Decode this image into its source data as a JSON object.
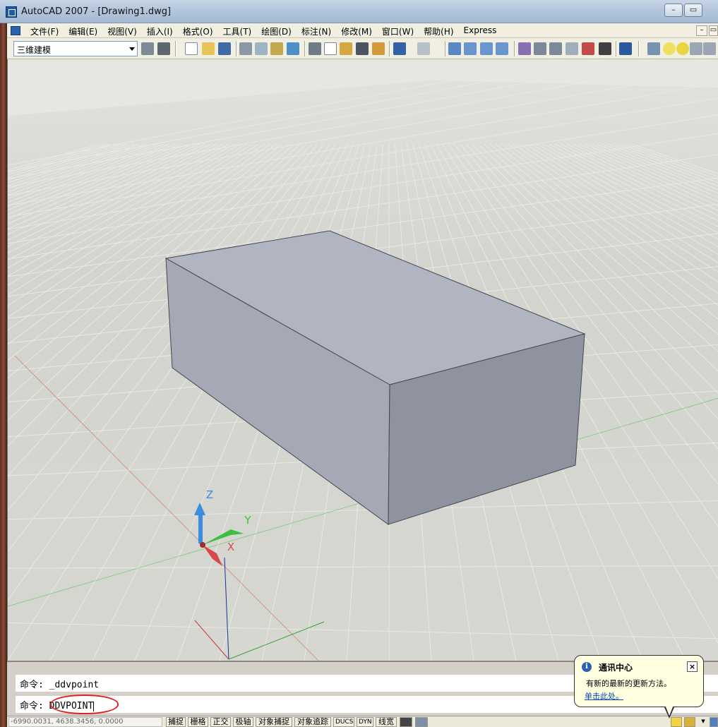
{
  "window": {
    "title": "AutoCAD 2007 - [Drawing1.dwg]",
    "minimize_label": "–",
    "restore_label": "▭"
  },
  "menu": {
    "items": [
      "文件(F)",
      "编辑(E)",
      "视图(V)",
      "插入(I)",
      "格式(O)",
      "工具(T)",
      "绘图(D)",
      "标注(N)",
      "修改(M)",
      "窗口(W)",
      "帮助(H)",
      "Express"
    ],
    "mdi_minimize": "–",
    "mdi_restore": "▭"
  },
  "toolbar": {
    "workspace": "三维建模"
  },
  "ucs": {
    "x_label": "X",
    "y_label": "Y",
    "z_label": "Z"
  },
  "command": {
    "history": "命令: _ddvpoint",
    "prompt": "命令:",
    "input": "DDVPOINT"
  },
  "status": {
    "coordinates": "-6990.0031, 4638.3456, 0.0000",
    "buttons": [
      "捕捉",
      "栅格",
      "正交",
      "极轴",
      "对象捕捉",
      "对象追踪",
      "DUCS",
      "DYN",
      "线宽"
    ]
  },
  "balloon": {
    "title": "通讯中心",
    "text": "有新的最新的更新方法。",
    "link": "单击此处。",
    "close_label": "×"
  },
  "colors": {
    "box_top": "#b1b5c1",
    "box_front": "#a5a9b6",
    "box_side": "#8e939f",
    "grid_line": "#e8e9e4",
    "axis_x": "#d64a4a",
    "axis_y": "#3cbf3c",
    "axis_z": "#3a8de0"
  }
}
